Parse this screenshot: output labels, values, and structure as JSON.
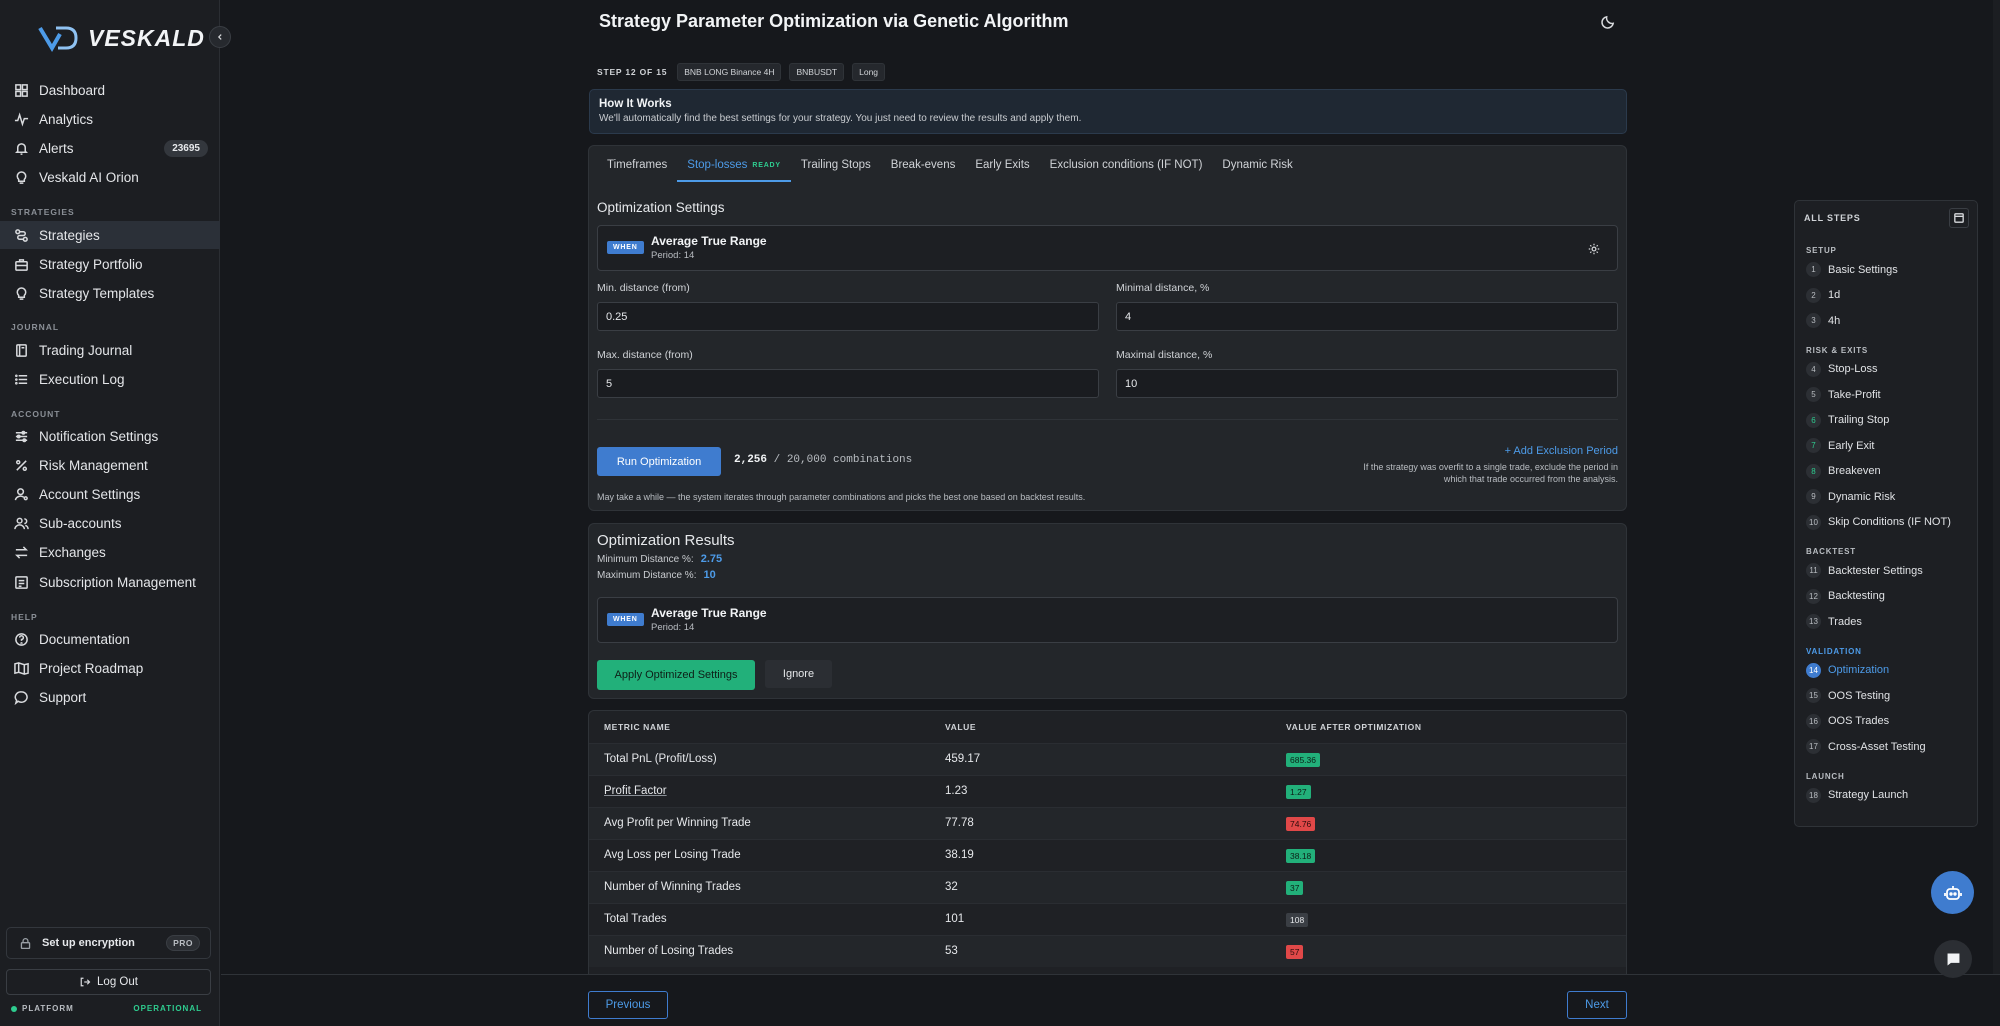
{
  "brand": {
    "name": "VESKALD"
  },
  "nav": {
    "items": [
      {
        "label": "Dashboard",
        "icon": "dashboard-icon"
      },
      {
        "label": "Analytics",
        "icon": "analytics-icon"
      },
      {
        "label": "Alerts",
        "icon": "bell-icon",
        "badge": "23695"
      },
      {
        "label": "Veskald AI Orion",
        "icon": "lightbulb-icon"
      }
    ],
    "sections": {
      "strategies": "STRATEGIES",
      "journal": "JOURNAL",
      "account": "ACCOUNT",
      "help": "HELP"
    },
    "strategies": [
      {
        "label": "Strategies",
        "icon": "route-icon"
      },
      {
        "label": "Strategy Portfolio",
        "icon": "briefcase-icon"
      },
      {
        "label": "Strategy Templates",
        "icon": "lightbulb-icon"
      }
    ],
    "journal": [
      {
        "label": "Trading Journal",
        "icon": "book-icon"
      },
      {
        "label": "Execution Log",
        "icon": "list-icon"
      }
    ],
    "account": [
      {
        "label": "Notification Settings",
        "icon": "sliders-icon"
      },
      {
        "label": "Risk Management",
        "icon": "percent-icon"
      },
      {
        "label": "Account Settings",
        "icon": "user-gear-icon"
      },
      {
        "label": "Sub-accounts",
        "icon": "users-icon"
      },
      {
        "label": "Exchanges",
        "icon": "arrows-exchange-icon"
      },
      {
        "label": "Subscription Management",
        "icon": "receipt-icon"
      }
    ],
    "help": [
      {
        "label": "Documentation",
        "icon": "help-circle-icon"
      },
      {
        "label": "Project Roadmap",
        "icon": "map-icon"
      },
      {
        "label": "Support",
        "icon": "chat-bubble-icon"
      }
    ],
    "encryption_label": "Set up encryption",
    "pro_badge": "PRO",
    "logout_label": "Log Out",
    "platform_label": "PLATFORM",
    "status_label": "OPERATIONAL"
  },
  "page": {
    "title": "Strategy Parameter Optimization via Genetic Algorithm",
    "step_label": "STEP 12 OF 15",
    "chips": [
      "BNB LONG Binance 4H",
      "BNBUSDT",
      "Long"
    ]
  },
  "how": {
    "title": "How It Works",
    "text": "We'll automatically find the best settings for your strategy. You just need to review the results and apply them."
  },
  "tabs": [
    {
      "label": "Timeframes"
    },
    {
      "label": "Stop-losses",
      "badge": "READY",
      "active": true
    },
    {
      "label": "Trailing Stops"
    },
    {
      "label": "Break-evens"
    },
    {
      "label": "Early Exits"
    },
    {
      "label": "Exclusion conditions (IF NOT)"
    },
    {
      "label": "Dynamic Risk"
    }
  ],
  "settings": {
    "title": "Optimization Settings",
    "indicator": {
      "when": "WHEN",
      "name": "Average True Range",
      "period": "Period: 14"
    },
    "min_from_label": "Min. distance (from)",
    "min_from_value": "0.25",
    "min_pct_label": "Minimal distance, %",
    "min_pct_value": "4",
    "max_from_label": "Max. distance (from)",
    "max_from_value": "5",
    "max_pct_label": "Maximal distance, %",
    "max_pct_value": "10",
    "run_label": "Run Optimization",
    "combos_count": "2,256",
    "combos_sep": " / ",
    "combos_total": "20,000",
    "combos_word": "combinations",
    "add_exclusion": "+ Add Exclusion Period",
    "exclusion_note": "If the strategy was overfit to a single trade, exclude the period in which that trade occurred from the analysis.",
    "note": "May take a while — the system iterates through parameter combinations and picks the best one based on backtest results."
  },
  "results": {
    "title": "Optimization Results",
    "min_label": "Minimum Distance %:",
    "min_value": "2.75",
    "max_label": "Maximum Distance %:",
    "max_value": "10",
    "indicator": {
      "when": "WHEN",
      "name": "Average True Range",
      "period": "Period: 14"
    },
    "apply_label": "Apply Optimized Settings",
    "ignore_label": "Ignore"
  },
  "metrics": {
    "headers": [
      "METRIC NAME",
      "VALUE",
      "VALUE AFTER OPTIMIZATION"
    ],
    "rows": [
      {
        "name": "Total PnL (Profit/Loss)",
        "value": "459.17",
        "after": "685.36",
        "tone": "green"
      },
      {
        "name": "Profit Factor",
        "value": "1.23",
        "after": "1.27",
        "tone": "green",
        "underline": true
      },
      {
        "name": "Avg Profit per Winning Trade",
        "value": "77.78",
        "after": "74.76",
        "tone": "red"
      },
      {
        "name": "Avg Loss per Losing Trade",
        "value": "38.19",
        "after": "38.18",
        "tone": "green"
      },
      {
        "name": "Number of Winning Trades",
        "value": "32",
        "after": "37",
        "tone": "green"
      },
      {
        "name": "Total Trades",
        "value": "101",
        "after": "108",
        "tone": "gray"
      },
      {
        "name": "Number of Losing Trades",
        "value": "53",
        "after": "57",
        "tone": "red"
      }
    ]
  },
  "footer": {
    "prev": "Previous",
    "next": "Next"
  },
  "steps": {
    "title": "ALL STEPS",
    "sections": [
      {
        "label": "SETUP",
        "items": [
          {
            "n": "1",
            "label": "Basic Settings"
          },
          {
            "n": "2",
            "label": "1d"
          },
          {
            "n": "3",
            "label": "4h"
          }
        ]
      },
      {
        "label": "RISK & EXITS",
        "items": [
          {
            "n": "4",
            "label": "Stop-Loss"
          },
          {
            "n": "5",
            "label": "Take-Profit"
          },
          {
            "n": "6",
            "label": "Trailing Stop",
            "done": true
          },
          {
            "n": "7",
            "label": "Early Exit",
            "done": true
          },
          {
            "n": "8",
            "label": "Breakeven",
            "done": true
          },
          {
            "n": "9",
            "label": "Dynamic Risk"
          },
          {
            "n": "10",
            "label": "Skip Conditions (IF NOT)"
          }
        ]
      },
      {
        "label": "BACKTEST",
        "items": [
          {
            "n": "11",
            "label": "Backtester Settings"
          },
          {
            "n": "12",
            "label": "Backtesting"
          },
          {
            "n": "13",
            "label": "Trades"
          }
        ]
      },
      {
        "label": "VALIDATION",
        "active": true,
        "items": [
          {
            "n": "14",
            "label": "Optimization",
            "active": true
          },
          {
            "n": "15",
            "label": "OOS Testing"
          },
          {
            "n": "16",
            "label": "OOS Trades"
          },
          {
            "n": "17",
            "label": "Cross-Asset Testing"
          }
        ]
      },
      {
        "label": "LAUNCH",
        "items": [
          {
            "n": "18",
            "label": "Strategy Launch"
          }
        ]
      }
    ]
  },
  "colors": {
    "accent": "#3f7ccf",
    "success": "#22b07a",
    "danger": "#e04848",
    "background": "#16181c"
  }
}
